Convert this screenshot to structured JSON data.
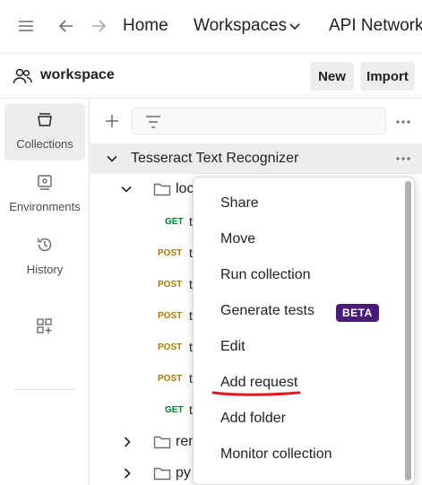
{
  "nav": {
    "home": "Home",
    "workspaces": "Workspaces",
    "api_network": "API Network"
  },
  "workspace": {
    "name": "workspace",
    "new_label": "New",
    "import_label": "Import"
  },
  "rail": {
    "items": [
      {
        "label": "Collections",
        "icon": "collections-icon",
        "active": true
      },
      {
        "label": "Environments",
        "icon": "environments-icon",
        "active": false
      },
      {
        "label": "History",
        "icon": "history-icon",
        "active": false
      }
    ],
    "configure_icon": "configure-workbench-icon"
  },
  "sidebar": {
    "collection_title": "Tesseract Text Recognizer",
    "folders": [
      {
        "name": "loc",
        "expanded": true
      },
      {
        "name": "ren",
        "expanded": false
      },
      {
        "name": "py",
        "expanded": false
      }
    ],
    "requests": [
      {
        "method": "GET",
        "name": "t"
      },
      {
        "method": "POST",
        "name": "t"
      },
      {
        "method": "POST",
        "name": "t"
      },
      {
        "method": "POST",
        "name": "t"
      },
      {
        "method": "POST",
        "name": "t"
      },
      {
        "method": "POST",
        "name": "t"
      },
      {
        "method": "GET",
        "name": "t"
      }
    ]
  },
  "context_menu": {
    "items": [
      {
        "label": "Share"
      },
      {
        "label": "Move"
      },
      {
        "label": "Run collection"
      },
      {
        "label": "Generate tests",
        "badge": "BETA"
      },
      {
        "label": "Edit"
      },
      {
        "label": "Add request",
        "highlighted": true
      },
      {
        "label": "Add folder"
      },
      {
        "label": "Monitor collection"
      }
    ]
  },
  "colors": {
    "get": "#007f31",
    "post": "#ad7a03",
    "beta_badge": "#4a1a7a",
    "annotation": "#e0191c",
    "active_bg": "#ededed"
  }
}
